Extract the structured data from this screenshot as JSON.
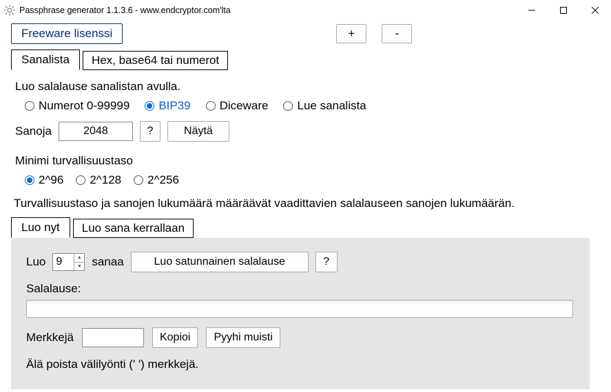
{
  "titlebar": {
    "title": "Passphrase generator 1.1.3.6 -  www.endcryptor.com'lta"
  },
  "license_button": "Freeware lisenssi",
  "font_plus": "+",
  "font_minus": "-",
  "main_tabs": {
    "tab1": "Sanalista",
    "tab2": "Hex, base64 tai numerot"
  },
  "wordlist": {
    "intro": "Luo salalause sanalistan avulla.",
    "opts": {
      "numbers": "Numerot 0-99999",
      "bip39": "BIP39",
      "diceware": "Diceware",
      "readlist": "Lue sanalista"
    },
    "words_label": "Sanoja",
    "words_count": "2048",
    "help": "?",
    "show": "Näytä"
  },
  "security": {
    "label": "Minimi turvallisuustaso",
    "opts": {
      "l96": "2^96",
      "l128": "2^128",
      "l256": "2^256"
    },
    "desc": "Turvallisuustaso ja sanojen lukumäärä määräävät vaadittavien salalauseen sanojen lukumäärän."
  },
  "gen_tabs": {
    "now": "Luo nyt",
    "one": "Luo sana kerrallaan"
  },
  "generate": {
    "make_prefix": "Luo",
    "count": "9",
    "make_suffix": "sanaa",
    "make_btn": "Luo satunnainen salalause",
    "help": "?",
    "passphrase_label": "Salalause:",
    "passphrase_value": "",
    "chars_label": "Merkkejä",
    "chars_value": "",
    "copy": "Kopioi",
    "wipe": "Pyyhi muisti",
    "note": "Älä poista välilyönti (' ') merkkejä."
  }
}
